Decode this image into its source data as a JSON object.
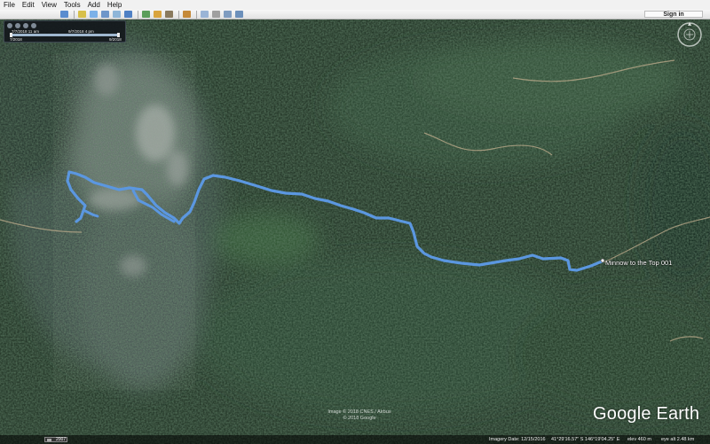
{
  "menu": [
    "File",
    "Edit",
    "View",
    "Tools",
    "Add",
    "Help"
  ],
  "toolbar": {
    "buttons": [
      "hide-sidebar-icon",
      "placemark-icon",
      "polygon-icon",
      "path-icon",
      "image-overlay-icon",
      "record-tour-icon",
      "historical-imagery-icon",
      "sunlight-icon",
      "planets-icon",
      "ruler-icon",
      "email-icon",
      "print-icon",
      "save-image-icon",
      "view-in-maps-icon"
    ],
    "sign_in": "Sign in"
  },
  "time_slider": {
    "start": "7/7/2018 11 am",
    "end": "9/7/2018 4 pm",
    "min": "7/2018",
    "max": "9/2018"
  },
  "placemark": {
    "label": "Minnow to the Top 001"
  },
  "copyright": {
    "line1": "Image © 2018 CNES / Airbus",
    "line2": "© 2018 Google"
  },
  "logo": {
    "text": "Google Earth"
  },
  "status": {
    "year": "2007",
    "imagery_date": "Imagery Date: 12/15/2016",
    "coords": "41°29'16.57\" S   146°19'04.25\" E",
    "elev": "elev   460 m",
    "eye_alt": "eye alt   2.48 km"
  },
  "colors": {
    "track": "#5b97e0",
    "toolbar_bg": "#ececec",
    "map_forest": "#26392a"
  }
}
